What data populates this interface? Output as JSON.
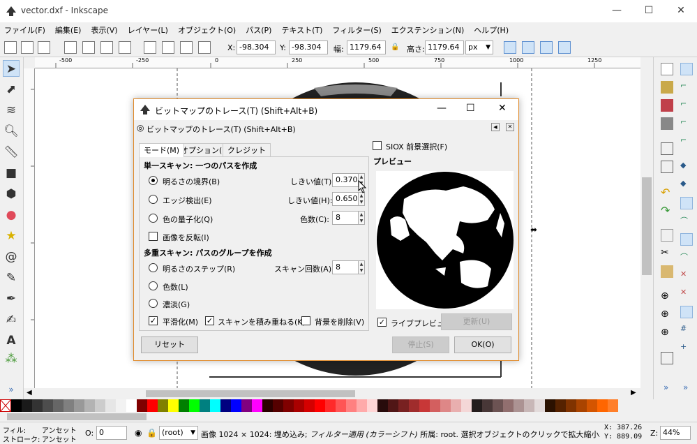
{
  "window": {
    "title": "vector.dxf - Inkscape",
    "minimize": "—",
    "maximize": "☐",
    "close": "✕"
  },
  "menu": [
    "ファイル(F)",
    "編集(E)",
    "表示(V)",
    "レイヤー(L)",
    "オブジェクト(O)",
    "パス(P)",
    "テキスト(T)",
    "フィルター(S)",
    "エクステンション(N)",
    "ヘルプ(H)"
  ],
  "controls": {
    "x_label": "X:",
    "x_value": "-98.304",
    "y_label": "Y:",
    "y_value": "-98.304",
    "w_label": "幅:",
    "w_value": "1179.64",
    "h_label": "高さ:",
    "h_value": "1179.64",
    "unit": "px"
  },
  "ruler_labels": [
    "-500",
    "-250",
    "0",
    "250",
    "500",
    "750",
    "1000",
    "1250"
  ],
  "dialog": {
    "title": "ビットマップのトレース(T) (Shift+Alt+B)",
    "subtitle": "ビットマップのトレース(T) (Shift+Alt+B)",
    "tabs": [
      "モード(M)",
      "オプション(P)",
      "クレジット"
    ],
    "single_scan_header": "単一スキャン: 一つのパスを作成",
    "radio_brightness": "明るさの境界(B)",
    "radio_edge": "エッジ検出(E)",
    "radio_color_quant": "色の量子化(Q)",
    "chk_invert": "画像を反転(I)",
    "threshold1_label": "しきい値(T):",
    "threshold1_value": "0.370",
    "threshold2_label": "しきい値(H):",
    "threshold2_value": "0.650",
    "colors_label": "色数(C):",
    "colors_value": "8",
    "multi_scan_header": "多重スキャン: パスのグループを作成",
    "radio_brightness_steps": "明るさのステップ(R)",
    "radio_colors": "色数(L)",
    "radio_grays": "濃淡(G)",
    "scans_label": "スキャン回数(A):",
    "scans_value": "8",
    "chk_smooth": "平滑化(M)",
    "chk_stack": "スキャンを積み重ねる(K)",
    "chk_remove_bg": "背景を削除(V)",
    "siox_label": "SIOX 前景選択(F)",
    "preview_label": "プレビュー",
    "live_preview_label": "ライブプレビュー",
    "update_button": "更新(U)",
    "reset_button": "リセット",
    "stop_button": "停止(S)",
    "ok_button": "OK(O)"
  },
  "status": {
    "fill_label": "フィル:",
    "fill_value": "アンセット",
    "stroke_label": "ストローク:",
    "stroke_value": "アンセット",
    "opacity_label": "O:",
    "opacity_value": "0",
    "layer": "(root)",
    "message_normal": "画像 1024 × 1024: 埋め込み;",
    "message_italic": " フィルター適用 (カラーシフト)",
    "message_rest": " 所属: root. 選択オブジェクトのクリックで拡大縮小ハンドル/回...",
    "x_coord": "X: 387.26",
    "y_coord": "Y: 889.09",
    "zoom_label": "Z:",
    "zoom_value": "44%"
  },
  "palette": [
    "#000000",
    "#1a1a1a",
    "#333333",
    "#4d4d4d",
    "#666666",
    "#808080",
    "#999999",
    "#b3b3b3",
    "#cccccc",
    "#e6e6e6",
    "#f2f2f2",
    "#ffffff",
    "#800000",
    "#ff0000",
    "#808000",
    "#ffff00",
    "#008000",
    "#00ff00",
    "#008080",
    "#00ffff",
    "#000080",
    "#0000ff",
    "#800080",
    "#ff00ff",
    "#2b0000",
    "#550000",
    "#800000",
    "#aa0000",
    "#d40000",
    "#ff0000",
    "#ff2a2a",
    "#ff5555",
    "#ff8080",
    "#ffaaaa",
    "#ffd5d5",
    "#280b0b",
    "#501616",
    "#782121",
    "#a02c2c",
    "#c83737",
    "#d35f5f",
    "#de8787",
    "#e9afaf",
    "#f4d7d7",
    "#241c1c",
    "#483737",
    "#6c5353",
    "#916f6f",
    "#ac9393",
    "#c8b7b7",
    "#e3dbdb",
    "#2b1100",
    "#552200",
    "#803300",
    "#aa4400",
    "#d45500",
    "#ff6600",
    "#ff7f2a"
  ]
}
